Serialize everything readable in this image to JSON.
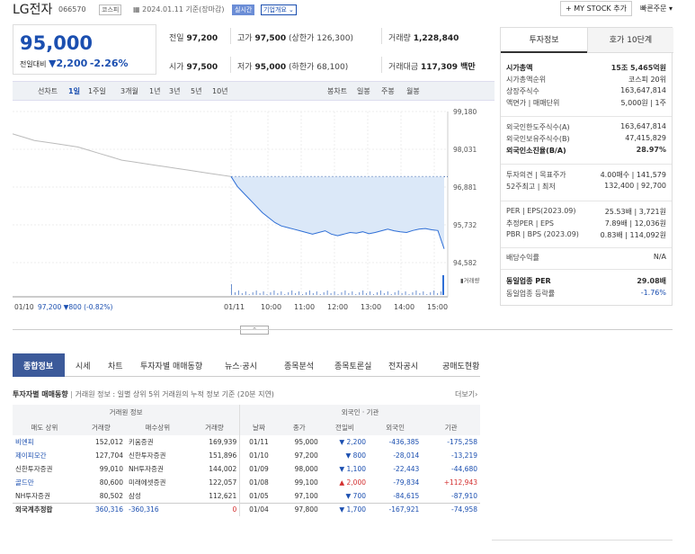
{
  "header": {
    "name": "LG전자",
    "code": "066570",
    "market": "코스피",
    "date": "2024.01.11 기준(장마감)",
    "realtime": "실시간",
    "company_overview": "기업개요",
    "mystock": "+ MY STOCK 추가",
    "quick_order": "빠른주문"
  },
  "price": {
    "current": "95,000",
    "change_label": "전일대비",
    "change": "▼2,200",
    "change_rate": "-2.26%"
  },
  "info": {
    "prev_label": "전일",
    "prev": "97,200",
    "high_label": "고가",
    "high": "97,500",
    "high_limit": "(상한가 126,300)",
    "volume_label": "거래량",
    "volume": "1,228,840",
    "open_label": "시가",
    "open": "97,500",
    "low_label": "저가",
    "low": "95,000",
    "low_limit": "(하한가 68,100)",
    "amount_label": "거래대금",
    "amount": "117,309 백만"
  },
  "chart_tabs": {
    "line": "선차트",
    "d1": "1일",
    "w1": "1주일",
    "m3": "3개월",
    "y1": "1년",
    "y3": "3년",
    "y5": "5년",
    "y10": "10년",
    "candle": "봉차트",
    "daily": "일봉",
    "weekly": "주봉",
    "monthly": "월봉"
  },
  "chart_data": {
    "type": "line",
    "y_ticks": [
      "99,180",
      "98,031",
      "96,881",
      "95,732",
      "94,582"
    ],
    "x_ticks": [
      "01/11",
      "10:00",
      "11:00",
      "12:00",
      "13:00",
      "14:00",
      "15:00"
    ],
    "prev_day_label": "01/10",
    "prev_day_text": "97,200 ▼800 (-0.82%)",
    "volume_label": "거래량",
    "prev_close": 97200,
    "ylim": [
      94582,
      99180
    ],
    "prev_day_series": [
      98500,
      98400,
      98300,
      98250,
      98200,
      98150,
      98100,
      98000,
      97900,
      97800,
      97700,
      97650,
      97600,
      97550,
      97500,
      97450,
      97400,
      97350,
      97300,
      97250,
      97200
    ],
    "today_series": [
      97200,
      96900,
      96700,
      96500,
      96300,
      96100,
      95950,
      95800,
      95700,
      95650,
      95600,
      95550,
      95500,
      95450,
      95500,
      95550,
      95450,
      95400,
      95450,
      95500,
      95480,
      95520,
      95460,
      95500,
      95550,
      95600,
      95550,
      95520,
      95500,
      95560,
      95600,
      95620,
      95580,
      95560,
      95000
    ]
  },
  "right": {
    "tab1": "투자정보",
    "tab2": "호가 10단계",
    "rows": [
      {
        "k": "시가총액",
        "v": "15조 5,465억원"
      },
      {
        "k": "시가총액순위",
        "v": "코스피 20위"
      },
      {
        "k": "상장주식수",
        "v": "163,647,814"
      },
      {
        "k": "액면가 | 매매단위",
        "v": "5,000원 | 1주"
      },
      {
        "k": "외국인한도주식수(A)",
        "v": "163,647,814"
      },
      {
        "k": "외국인보유주식수(B)",
        "v": "47,415,829"
      },
      {
        "k": "외국인소진율(B/A)",
        "v": "28.97%"
      },
      {
        "k": "투자의견 | 목표주가",
        "v": "4.00매수 | 141,579"
      },
      {
        "k": "52주최고 | 최저",
        "v": "132,400 | 92,700"
      },
      {
        "k": "PER | EPS(2023.09)",
        "v": "25.53배 | 3,721원"
      },
      {
        "k": "추정PER | EPS",
        "v": "7.89배 | 12,036원"
      },
      {
        "k": "PBR | BPS (2023.09)",
        "v": "0.83배 | 114,092원"
      },
      {
        "k": "배당수익률",
        "v": "N/A"
      },
      {
        "k": "동일업종 PER",
        "v": "29.08배"
      },
      {
        "k": "동일업종 등락률",
        "v": "-1.76%"
      }
    ]
  },
  "nav": [
    "종합정보",
    "시세",
    "차트",
    "투자자별 매매동향",
    "뉴스·공시",
    "종목분석",
    "종목토론실",
    "전자공시",
    "공매도현황"
  ],
  "trading": {
    "title": "투자자별 매매동향",
    "subtitle": "거래원 정보 : 일별 상위 5위 거래원의 누적 정보 기준 (20분 지연)",
    "more": "더보기",
    "group1": "거래원 정보",
    "group2": "외국인 · 기관",
    "cols": [
      "매도 상위",
      "거래량",
      "매수상위",
      "거래량",
      "날짜",
      "종가",
      "전일비",
      "외국인",
      "기관"
    ],
    "rows": [
      [
        "비엔피",
        "152,012",
        "키움증권",
        "169,939",
        "01/11",
        "95,000",
        "▼ 2,200",
        "-436,385",
        "-175,258"
      ],
      [
        "제이피모간",
        "127,704",
        "신한투자증권",
        "151,896",
        "01/10",
        "97,200",
        "▼ 800",
        "-28,014",
        "-13,219"
      ],
      [
        "신한투자증권",
        "99,010",
        "NH투자증권",
        "144,002",
        "01/09",
        "98,000",
        "▼ 1,100",
        "-22,443",
        "-44,680"
      ],
      [
        "골드만",
        "80,600",
        "미래에셋증권",
        "122,057",
        "01/08",
        "99,100",
        "▲ 2,000",
        "-79,834",
        "+112,943"
      ],
      [
        "NH투자증권",
        "80,502",
        "삼성",
        "112,621",
        "01/05",
        "97,100",
        "▼ 700",
        "-84,615",
        "-87,910"
      ],
      [
        "외국계추정합",
        "360,316",
        "-360,316",
        "0",
        "01/04",
        "97,800",
        "▼ 1,700",
        "-167,921",
        "-74,958"
      ]
    ]
  }
}
